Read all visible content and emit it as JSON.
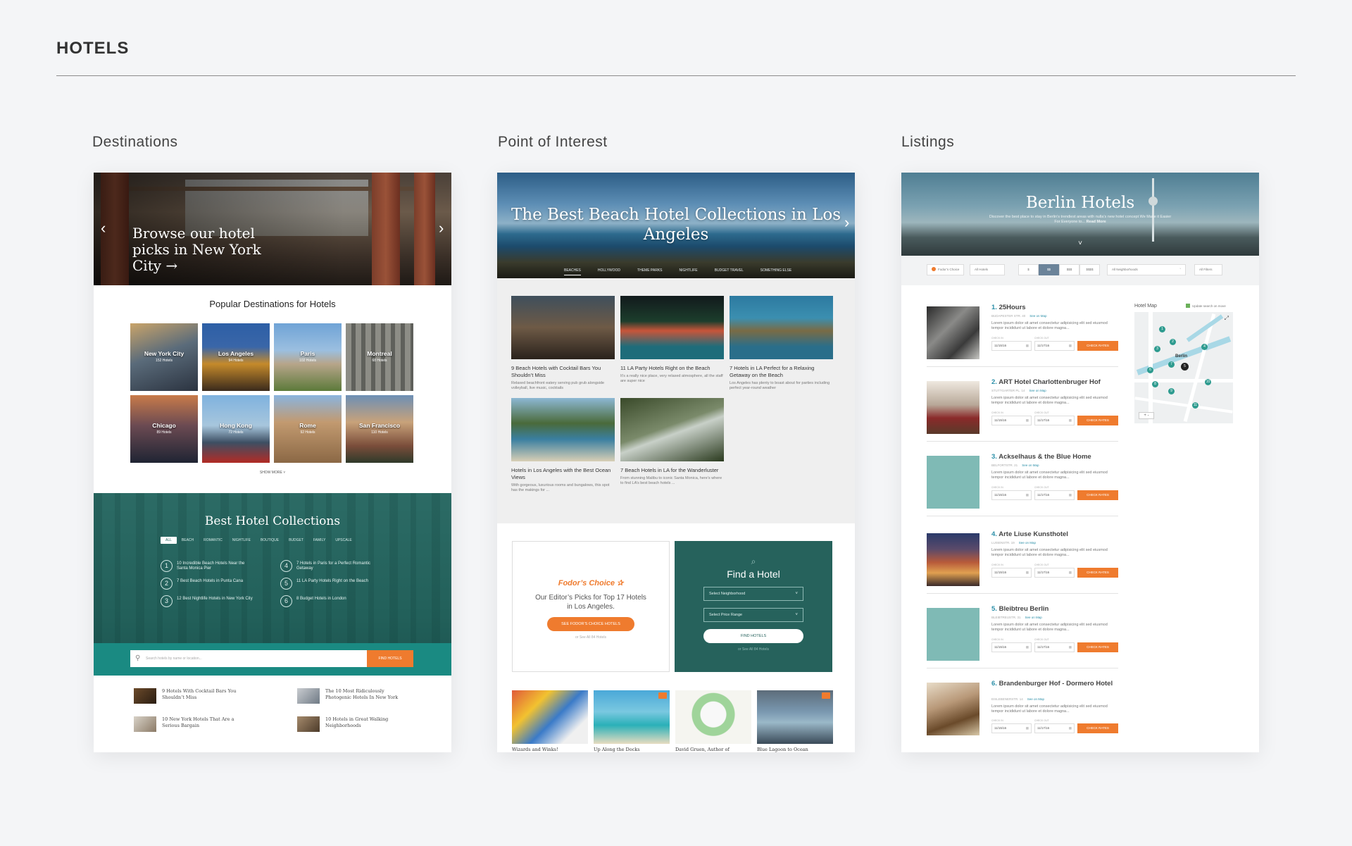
{
  "page": {
    "title": "HOTELS"
  },
  "columns": {
    "destinations": "Destinations",
    "poi": "Point of Interest",
    "listings": "Listings"
  },
  "destinations": {
    "hero_text": "Browse our hotel picks in New York City →",
    "arrow_left": "‹",
    "arrow_right": "›",
    "popular_title": "Popular Destinations for Hotels",
    "cities": [
      {
        "name": "New York City",
        "count": "152 Hotels"
      },
      {
        "name": "Los Angeles",
        "count": "94 Hotels"
      },
      {
        "name": "Paris",
        "count": "102 Hotels"
      },
      {
        "name": "Montreal",
        "count": "68 Hotels"
      },
      {
        "name": "Chicago",
        "count": "89 Hotels"
      },
      {
        "name": "Hong Kong",
        "count": "72 Hotels"
      },
      {
        "name": "Rome",
        "count": "92 Hotels"
      },
      {
        "name": "San Francisco",
        "count": "110 Hotels"
      }
    ],
    "show_more": "SHOW MORE ˅",
    "collections_title": "Best Hotel Collections",
    "filters": [
      "ALL",
      "BEACH",
      "ROMANTIC",
      "NIGHTLIFE",
      "BOUTIQUE",
      "BUDGET",
      "FAMILY",
      "UPSCALE"
    ],
    "collections": [
      {
        "num": "1",
        "text": "10 Incredible Beach Hotels Near the Santa Monica Pier"
      },
      {
        "num": "4",
        "text": "7 Hotels in Paris for a Perfect Romantic Getaway"
      },
      {
        "num": "2",
        "text": "7 Best Beach Hotels in Punta Cana"
      },
      {
        "num": "5",
        "text": "11 LA Party Hotels Right on the Beach"
      },
      {
        "num": "3",
        "text": "12 Best Nightlife Hotels in New York City"
      },
      {
        "num": "6",
        "text": "8 Budget Hotels in London"
      }
    ],
    "search_placeholder": "Search hotels by name or location...",
    "search_button": "FIND HOTELS",
    "articles": [
      "9 Hotels With Cocktail Bars You Shouldn’t Miss",
      "The 10 Most Ridiculously Photogenic Hotels In New York",
      "10 New York Hotels That Are a Serious Bargain",
      "10 Hotels in Great Walking Neighborhoods"
    ]
  },
  "poi": {
    "hero_title": "The Best Beach Hotel Collections in Los Angeles",
    "arrow_right": "›",
    "tabs": [
      "BEACHES",
      "HOLLYWOOD",
      "THEME PARKS",
      "NIGHTLIFE",
      "BUDGET TRAVEL",
      "SOMETHING ELSE"
    ],
    "cards": [
      {
        "title": "9 Beach Hotels with Cocktail Bars You Shouldn’t Miss",
        "desc": "Relaxed beachfront eatery serving pub grub alongside volleyball, live music, cocktails"
      },
      {
        "title": "11 LA Party Hotels Right on the Beach",
        "desc": "It’s a really nice place, very relaxed atmosphere, all the staff are super nice"
      },
      {
        "title": "7 Hotels in LA Perfect for a Relaxing Getaway on the Beach",
        "desc": "Los Angeles has plenty to boast about for parties including perfect year-round weather"
      },
      {
        "title": "Hotels in Los Angeles with the Best Ocean Views",
        "desc": "With gorgeous, luxurious rooms and bungalows, this spot has the makings for ..."
      },
      {
        "title": "7 Beach Hotels in LA for the Wanderluster",
        "desc": "From stunning Malibu to iconic Santa Monica, here’s where to find LA’s best beach hotels ..."
      }
    ],
    "fodor_logo": "Fodor’s Choice ✰",
    "fodor_text": "Our Editor’s Picks for Top 17 Hotels in Los Angeles.",
    "fodor_button": "SEE FODOR’S CHOICE HOTELS",
    "fodor_small": "or See All 84 Hotels",
    "find_icon": "⌕",
    "find_title": "Find a Hotel",
    "select_neighborhood": "Select Neighborhood",
    "select_price": "Select Price Range",
    "select_chevron": "˅",
    "find_button": "FIND HOTELS",
    "find_small": "or See All 84 Hotels",
    "bottom_captions": [
      "Wizards and Winks!",
      "Up Along the Docks",
      "David Gruen, Author of",
      "Blue Lagoon to Ocean"
    ]
  },
  "listings": {
    "hero_title": "Berlin Hotels",
    "hero_sub": "Discover the best place to stay in Berlin’s trendiest areas with nulla’s new hotel concept We Make it Easier For Everyone to...",
    "read_more": "Read More",
    "hero_chevron": "˅",
    "filters": {
      "fodors_choice": "Fodor’s Choice",
      "all_hotels": "All Hotels",
      "prices": [
        "$",
        "$$",
        "$$$",
        "$$$$"
      ],
      "neighborhoods": "All Neighborhoods",
      "all_filters": "All Filters"
    },
    "check_in_label": "CHECK IN",
    "check_out_label": "CHECK OUT",
    "see_on_map": "See on Map",
    "check_rates": "CHECK RATES",
    "desc": "Lorem ipsum dolor sit amet consectetur adipisicing elit sed eiusmod tempor incididunt ut labore et dolore magna...",
    "hotels": [
      {
        "num": "1.",
        "name": "25Hours",
        "addr": "BUDAPESTER STR. 40",
        "check_in": "11/15/16",
        "check_out": "11/17/16"
      },
      {
        "num": "2.",
        "name": "ART Hotel Charlottenbruger Hof",
        "addr": "STUTTGARTER PL. 14",
        "check_in": "11/15/16",
        "check_out": "11/17/16"
      },
      {
        "num": "3.",
        "name": "Ackselhaus & the Blue Home",
        "addr": "BELFORTSTR. 21",
        "check_in": "11/15/16",
        "check_out": "11/17/16"
      },
      {
        "num": "4.",
        "name": "Arte Liuse Kunsthotel",
        "addr": "LUISENSTR. 19",
        "check_in": "11/15/16",
        "check_out": "11/17/16"
      },
      {
        "num": "5.",
        "name": "Bleibtreu Berlin",
        "addr": "BLEIBTREUSTR. 31",
        "check_in": "11/15/16",
        "check_out": "11/17/16"
      },
      {
        "num": "6.",
        "name": "Brandenburger Hof - Dormero Hotel",
        "addr": "EISLEBENERSTR. 14",
        "check_in": "11/15/16",
        "check_out": "11/17/16"
      }
    ],
    "map_title": "Hotel Map",
    "map_update": "Update search on move",
    "map_city": "Berlin",
    "map_zoom": "+ -",
    "map_expand": "⤢",
    "map_pins": [
      "1",
      "2",
      "3",
      "4",
      "5",
      "6",
      "7",
      "8",
      "9",
      "10",
      "11"
    ]
  },
  "colors": {
    "accent": "#ef7b2e",
    "teal": "#26625c",
    "link": "#2b8fa8"
  }
}
